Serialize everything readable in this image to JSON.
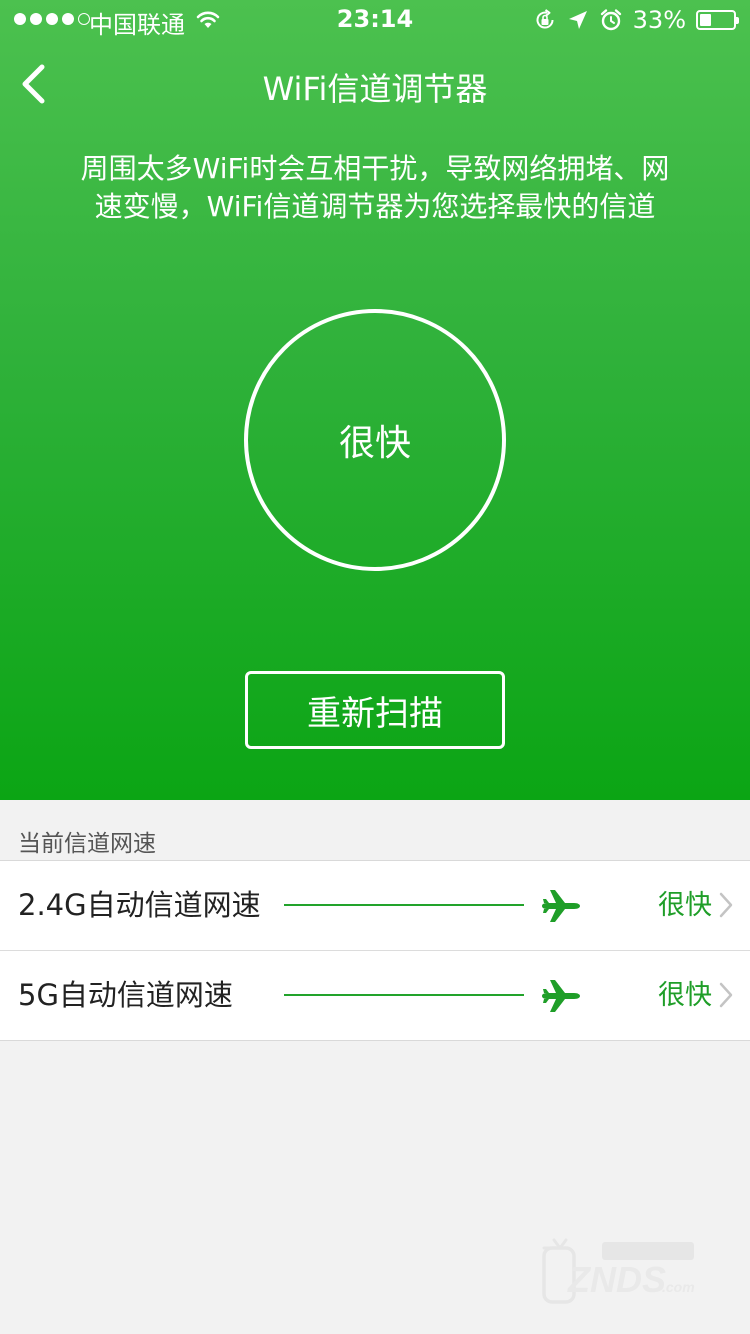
{
  "status_bar": {
    "carrier": "中国联通",
    "time": "23:14",
    "battery_percent": "33%",
    "battery_level": 0.33,
    "signal_bars_filled": 4,
    "signal_bars_total": 5,
    "icons": [
      "wifi-icon",
      "rotation-lock-icon",
      "location-arrow-icon",
      "alarm-icon",
      "battery-icon"
    ]
  },
  "nav": {
    "back_icon": "chevron-left-icon",
    "title": "WiFi信道调节器"
  },
  "hero": {
    "description_line1": "周围太多WiFi时会互相干扰，导致网络拥堵、网",
    "description_line2": "速变慢，WiFi信道调节器为您选择最快的信道",
    "speed_status": "很快",
    "rescan_label": "重新扫描"
  },
  "list": {
    "section_title": "当前信道网速",
    "items": [
      {
        "label": "2.4G自动信道网速",
        "value": "很快",
        "icon": "airplane-icon"
      },
      {
        "label": "5G自动信道网速",
        "value": "很快",
        "icon": "airplane-icon"
      }
    ]
  },
  "colors": {
    "hero_top": "#4cc14f",
    "hero_bottom": "#0ba514",
    "accent_green": "#1f9e28",
    "background": "#f2f2f2"
  }
}
